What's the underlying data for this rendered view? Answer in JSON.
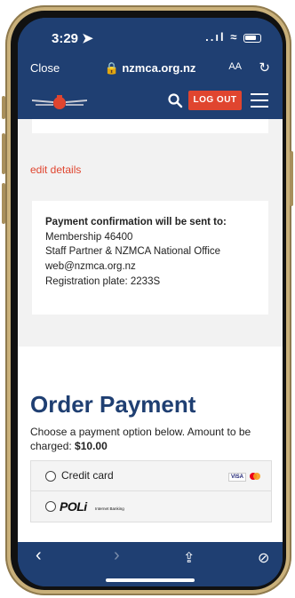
{
  "status": {
    "time": "3:29 ➤",
    "signal": "..ıl ≈"
  },
  "browser": {
    "close_label": "Close",
    "url": "🔒 nzmca.org.nz",
    "aa_label": "AA",
    "reload_icon": "reload-icon"
  },
  "header": {
    "logout_label": "LOG OUT",
    "search_icon": "search-icon",
    "menu_icon": "hamburger-menu-icon"
  },
  "page": {
    "edit_link": "edit details",
    "confirmation": {
      "heading": "Payment confirmation will be sent to:",
      "lines": [
        "Membership 46400",
        "Staff Partner & NZMCA National Office",
        "web@nzmca.org.nz",
        "Registration plate: 2233S"
      ]
    },
    "order": {
      "title": "Order Payment",
      "desc_prefix": "Choose a payment option below. Amount to be charged: ",
      "amount": "$10.00",
      "options": [
        {
          "label": "Credit card",
          "visa": "VISA"
        },
        {
          "label": "POLi",
          "sub": "Internet Banking"
        }
      ]
    }
  },
  "toolbar": {
    "back": "‹",
    "forward": "›",
    "share": "⇪",
    "compass": "⊘"
  },
  "colors": {
    "brand": "#1f3f72",
    "accent": "#e0452f"
  }
}
